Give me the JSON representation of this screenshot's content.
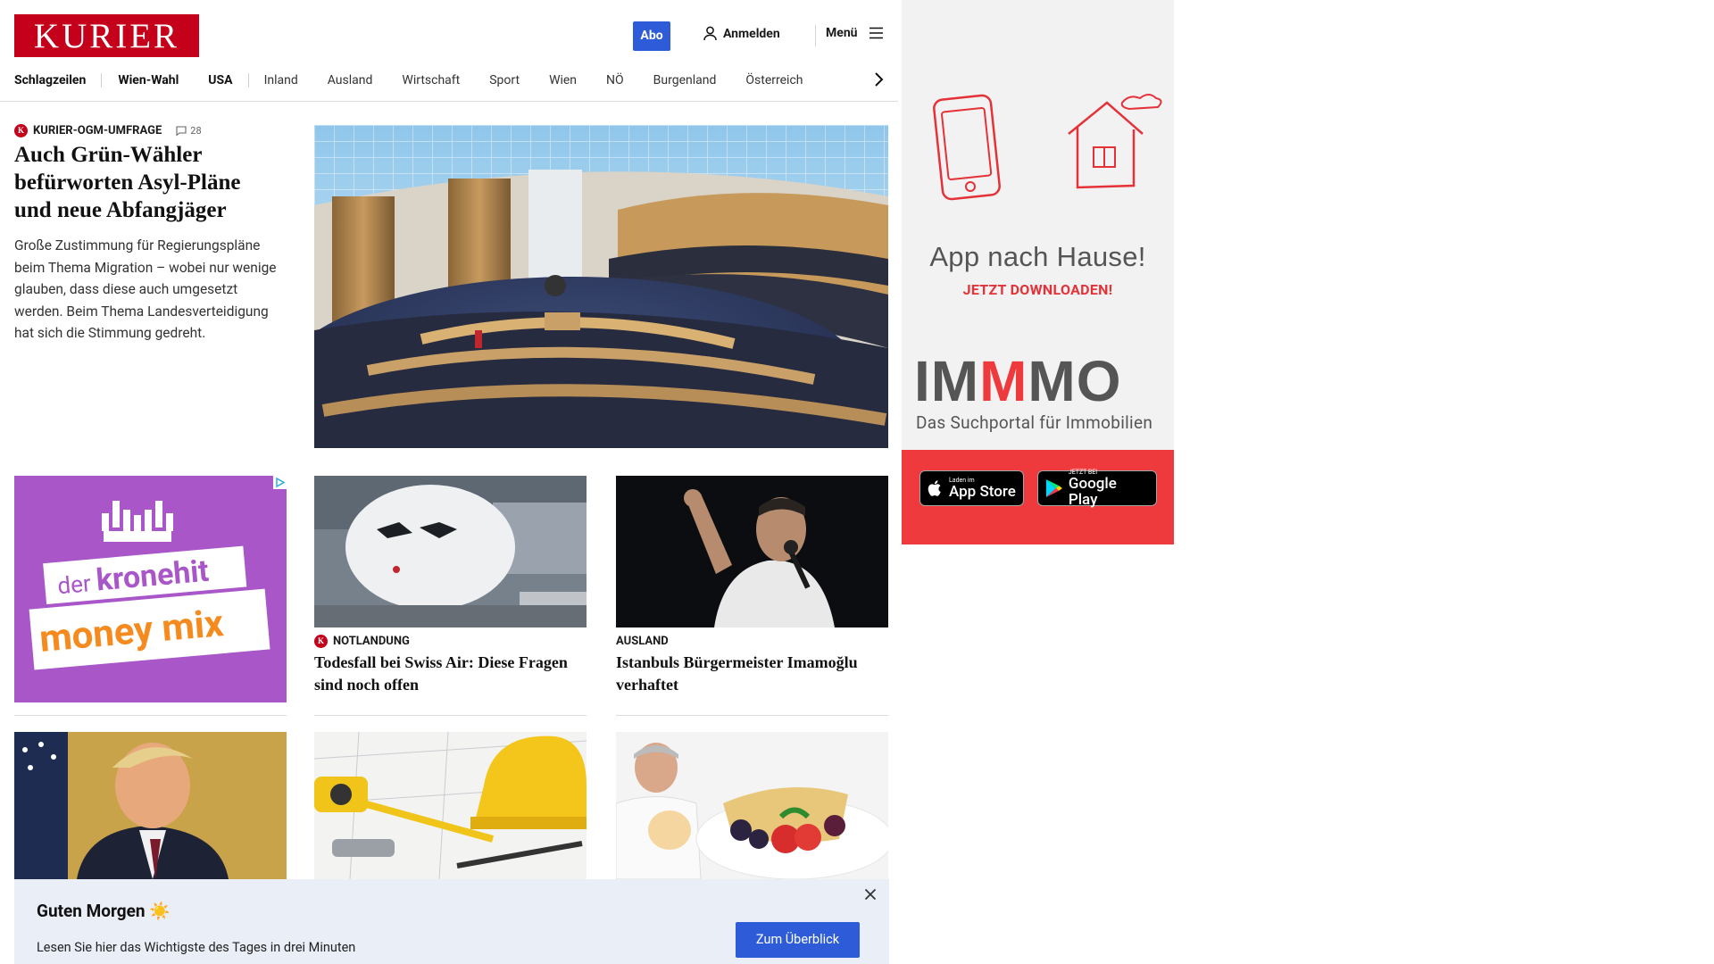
{
  "header": {
    "logo": "KURIER",
    "abo_label": "Abo",
    "login_label": "Anmelden",
    "menu_label": "Menü"
  },
  "nav": {
    "items": [
      "Schlagzeilen",
      "Wien-Wahl",
      "USA",
      "Inland",
      "Ausland",
      "Wirtschaft",
      "Sport",
      "Wien",
      "NÖ",
      "Burgenland",
      "Österreich"
    ]
  },
  "lead": {
    "kicker": "KURIER-OGM-UMFRAGE",
    "comments": "28",
    "title": "Auch Grün-Wähler befürworten Asyl-Pläne und neue Abfangjäger",
    "text": "Große Zustimmung für Regierungspläne beim Thema Migration – wobei nur wenige glauben, dass diese auch umgesetzt werden. Beim Thema Landesverteidigung hat sich die Stimmung gedreht."
  },
  "ad_krone": {
    "line1": "der",
    "line2": "kronehit",
    "line3": "money mix"
  },
  "teasers": [
    {
      "kicker": "NOTLANDUNG",
      "title": "Todesfall bei Swiss Air: Diese Fragen sind noch offen"
    },
    {
      "kicker": "AUSLAND",
      "title": "Istanbuls Bürgermeister Imamoğlu verhaftet"
    }
  ],
  "side_ad": {
    "claim": "App nach Hause!",
    "download": "JETZT DOWNLOADEN!",
    "brand_a": "IM",
    "brand_b": "M",
    "brand_c": "MO",
    "subtitle": "Das Suchportal für Immobilien",
    "appstore_small": "Laden im",
    "appstore_big": "App Store",
    "gplay_small": "JETZT BEI",
    "gplay_big": "Google Play"
  },
  "notification": {
    "title": "Guten Morgen",
    "text": "Lesen Sie hier das Wichtigste des Tages in drei Minuten",
    "button": "Zum Überblick"
  },
  "colors": {
    "brand_red": "#c4001a",
    "accent_blue": "#2e5bd7",
    "ad_purple": "#a956c9",
    "immmo_red": "#ef3a3d"
  }
}
